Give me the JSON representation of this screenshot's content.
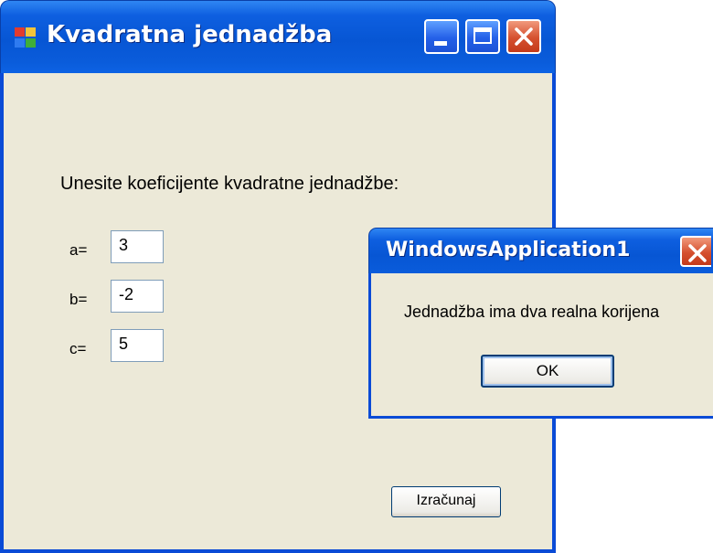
{
  "main_window": {
    "title": "Kvadratna jednadžba",
    "prompt": "Unesite koeficijente kvadratne jednadžbe:",
    "fields": [
      {
        "label": "a=",
        "value": "3"
      },
      {
        "label": "b=",
        "value": "-2"
      },
      {
        "label": "c=",
        "value": "5"
      }
    ],
    "calculate_label": "Izračunaj"
  },
  "dialog": {
    "title": "WindowsApplication1",
    "message": "Jednadžba ima dva realna korijena",
    "ok_label": "OK"
  },
  "colors": {
    "titlebar": "#0756d4",
    "window_body": "#ece9d8",
    "close_button": "#d5502f"
  },
  "icons": [
    "app-icon",
    "minimize-icon",
    "maximize-icon",
    "close-icon",
    "dialog-close-icon"
  ]
}
